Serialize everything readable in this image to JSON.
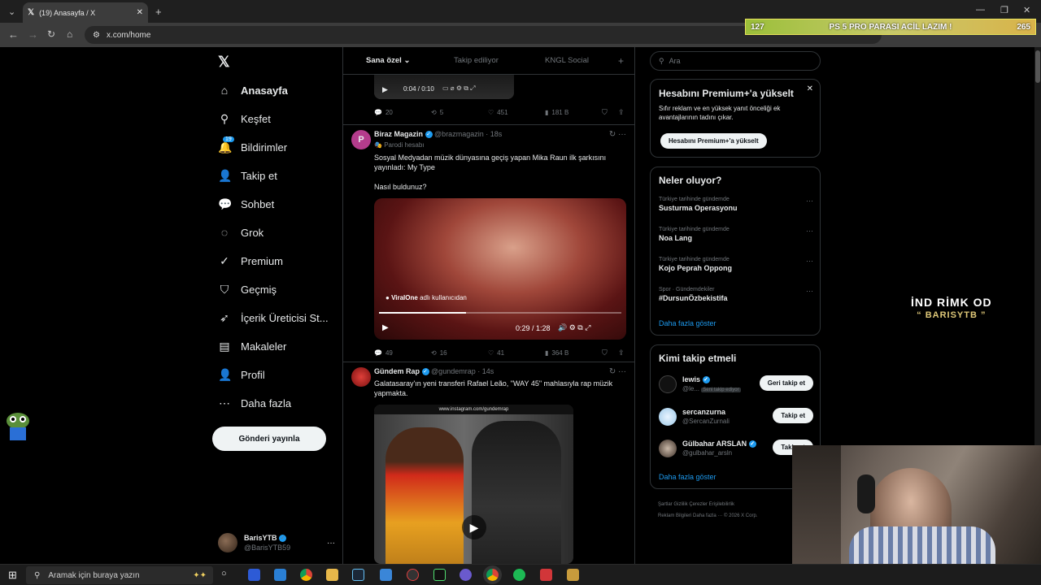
{
  "browser": {
    "tab_title": "(19) Anasayfa / X",
    "url": "x.com/home"
  },
  "stream_ticker": {
    "left": "127",
    "message": "PS 5 PRO PARASI ACİL LAZIM !",
    "right": "265"
  },
  "nav": {
    "items": [
      {
        "label": "Anasayfa",
        "icon": "home-icon"
      },
      {
        "label": "Keşfet",
        "icon": "search-icon"
      },
      {
        "label": "Bildirimler",
        "icon": "bell-icon",
        "badge": "19"
      },
      {
        "label": "Takip et",
        "icon": "add-person-icon"
      },
      {
        "label": "Sohbet",
        "icon": "chat-icon"
      },
      {
        "label": "Grok",
        "icon": "grok-icon"
      },
      {
        "label": "Premium",
        "icon": "verified-icon"
      },
      {
        "label": "Geçmiş",
        "icon": "bookmark-icon"
      },
      {
        "label": "İçerik Üreticisi St...",
        "icon": "rocket-icon"
      },
      {
        "label": "Makaleler",
        "icon": "article-icon"
      },
      {
        "label": "Profil",
        "icon": "person-icon"
      },
      {
        "label": "Daha fazla",
        "icon": "more-circle-icon"
      }
    ],
    "post_button": "Gönderi yayınla",
    "account": {
      "name": "BarisYTB",
      "handle": "@BarisYTB59"
    }
  },
  "feed": {
    "tabs": [
      "Sana özel",
      "Takip ediliyor",
      "KNGL Social"
    ],
    "top_video_time": "0:04 / 0:10",
    "tweet0_stats": {
      "replies": "20",
      "reposts": "5",
      "likes": "451",
      "views": "181 B"
    },
    "tweet1": {
      "name": "Biraz Magazin",
      "handle": "@brazmagazin · 18s",
      "parody": "Parodi hesabı",
      "text": "Sosyal Medyadan müzik dünyasına geçiş yapan Mika Raun ilk şarkısını yayınladı: My Type",
      "text2": "Nasıl buldunuz?",
      "video_credit": "ViralOne",
      "video_credit_suffix": "adlı kullanıcıdan",
      "video_time": "0:29 / 1:28",
      "video_progress": 0.36,
      "stats": {
        "replies": "49",
        "reposts": "16",
        "likes": "41",
        "views": "364 B"
      }
    },
    "tweet2": {
      "name": "Gündem Rap",
      "handle": "@gundemrap · 14s",
      "text": "Galatasaray'ın yeni transferi Rafael Leão, \"WAY 45\" mahlasıyla rap müzik yapmakta.",
      "watermark": "www.instagram.com/gundemrap"
    }
  },
  "sidebar": {
    "search_placeholder": "Ara",
    "premium": {
      "title": "Hesabını Premium+'a yükselt",
      "body": "Sıfır reklam ve en yüksek yanıt önceliği ek avantajlarının tadını çıkar.",
      "button": "Hesabını Premium+'a yükselt"
    },
    "trends_title": "Neler oluyor?",
    "trends": [
      {
        "category": "Türkiye tarihinde gündemde",
        "name": "Susturma Operasyonu"
      },
      {
        "category": "Türkiye tarihinde gündemde",
        "name": "Noa Lang"
      },
      {
        "category": "Türkiye tarihinde gündemde",
        "name": "Kojo Peprah Oppong"
      },
      {
        "category": "Spor · Gündemdekiler",
        "name": "#DursunÖzbekistifa"
      }
    ],
    "more_link": "Daha fazla göster",
    "who_title": "Kimi takip etmeli",
    "who": [
      {
        "name": "lewis",
        "handle": "@le...",
        "tag": "Seni takip ediyor",
        "button": "Geri takip et"
      },
      {
        "name": "sercanzurna",
        "handle": "@SercanZurnali",
        "button": "Takip et"
      },
      {
        "name": "Gülbahar ARSLAN",
        "handle": "@gulbahar_arsln",
        "button": "Takip et"
      }
    ],
    "who_more": "Daha fazla göster",
    "footer_line1": "Şartlar   Gizlilik   Çerezler   Erişilebilirlik",
    "footer_line2": "Reklam Bilgileri   Daha fazla ···   © 2026 X Corp."
  },
  "overlay": {
    "line1": "İND RİMK OD",
    "line2": "“ BARISYTB ”"
  },
  "taskbar": {
    "search_placeholder": "Aramak için buraya yazın"
  }
}
